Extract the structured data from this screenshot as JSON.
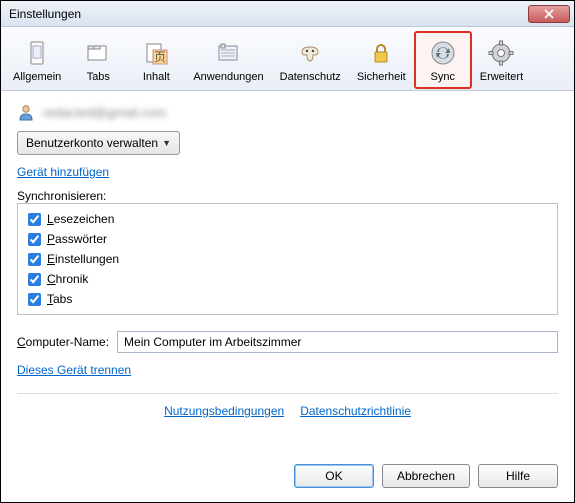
{
  "window": {
    "title": "Einstellungen"
  },
  "toolbar": {
    "items": [
      {
        "label": "Allgemein"
      },
      {
        "label": "Tabs"
      },
      {
        "label": "Inhalt"
      },
      {
        "label": "Anwendungen"
      },
      {
        "label": "Datenschutz"
      },
      {
        "label": "Sicherheit"
      },
      {
        "label": "Sync"
      },
      {
        "label": "Erweitert"
      }
    ],
    "selected": "Sync"
  },
  "user": {
    "email": "redacted@gmail.com"
  },
  "buttons": {
    "manage_account": "Benutzerkonto verwalten",
    "ok": "OK",
    "cancel": "Abbrechen",
    "help": "Hilfe"
  },
  "links": {
    "add_device": "Gerät hinzufügen",
    "disconnect": "Dieses Gerät trennen",
    "terms": "Nutzungsbedingungen",
    "privacy": "Datenschutzrichtlinie"
  },
  "sync": {
    "heading": "Synchronisieren:",
    "items": [
      {
        "label": "Lesezeichen",
        "underline": "L",
        "rest": "esezeichen",
        "checked": true
      },
      {
        "label": "Passwörter",
        "underline": "P",
        "rest": "asswörter",
        "checked": true
      },
      {
        "label": "Einstellungen",
        "underline": "E",
        "rest": "instellungen",
        "checked": true
      },
      {
        "label": "Chronik",
        "underline": "C",
        "rest": "hronik",
        "checked": true
      },
      {
        "label": "Tabs",
        "underline": "T",
        "rest": "abs",
        "checked": true
      }
    ]
  },
  "computer_name": {
    "label_underline": "C",
    "label_rest": "omputer-Name:",
    "value": "Mein Computer im Arbeitszimmer"
  }
}
